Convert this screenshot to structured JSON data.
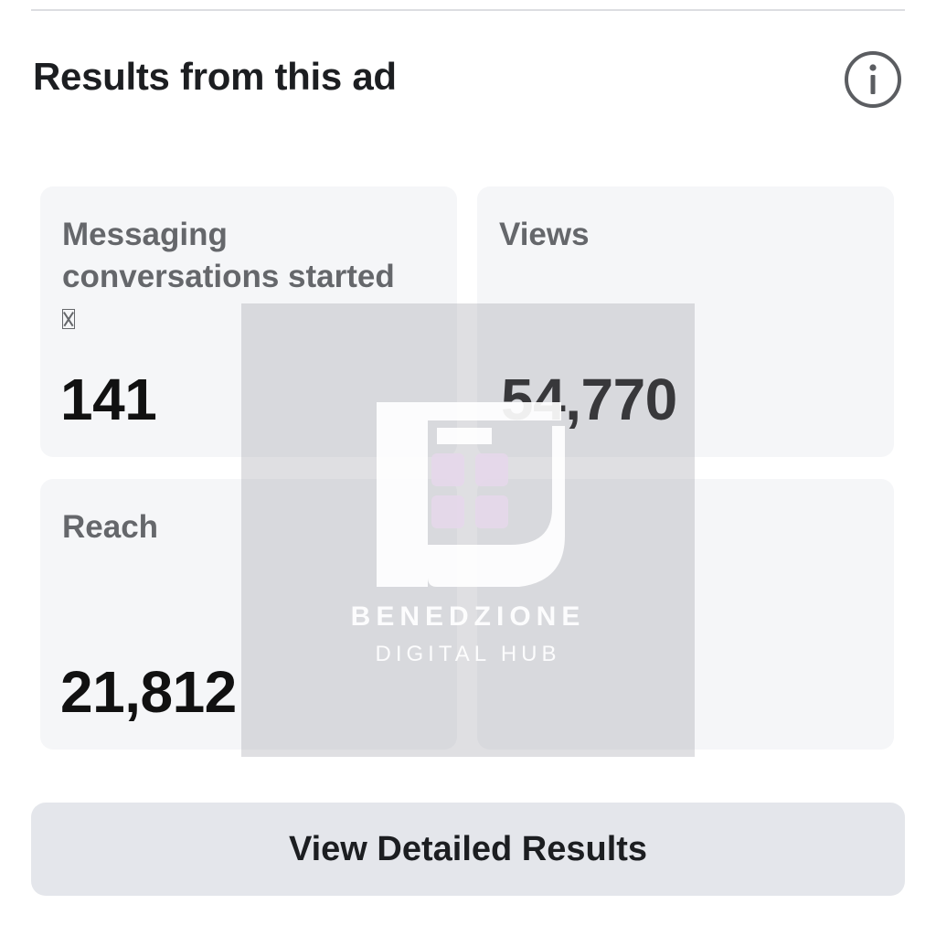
{
  "header": {
    "title": "Results from this ad"
  },
  "icons": {
    "info": "info-icon",
    "unknown_glyph": "missing-glyph-icon"
  },
  "metrics": {
    "messaging": {
      "label": "Messaging conversations started",
      "value": "141"
    },
    "views": {
      "label": "Views",
      "value": "54,770"
    },
    "reach": {
      "label": "Reach",
      "value": "21,812"
    }
  },
  "actions": {
    "detailed_results_label": "View Detailed Results"
  },
  "watermark": {
    "brand": "BENEDZIONE",
    "subtitle": "DIGITAL HUB"
  },
  "colors": {
    "card_bg": "#f5f6f8",
    "button_bg": "#e4e6eb",
    "label_text": "#65676b",
    "value_text": "#111111"
  }
}
